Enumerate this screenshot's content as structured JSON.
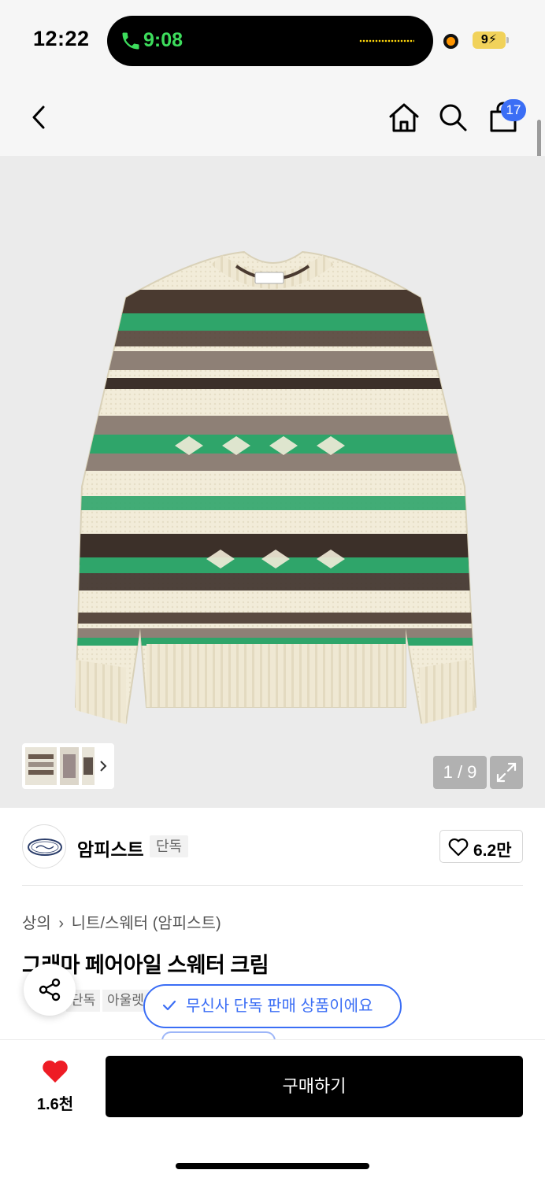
{
  "status_bar": {
    "time": "12:22",
    "call_time": "9:08",
    "battery": "9"
  },
  "header": {
    "cart_count": "17"
  },
  "gallery": {
    "counter": "1 / 9"
  },
  "brand": {
    "name": "암피스트",
    "tag": "단독",
    "likes": "6.2만"
  },
  "product": {
    "breadcrumb": [
      "상의",
      "니트/스웨터 (암피스트)"
    ],
    "title": "그래마 페어아일 스웨터 크림",
    "tags": [
      "단독",
      "아울렛"
    ]
  },
  "toast": {
    "message": "무신사 단독 판매 상품이에요"
  },
  "bottom_bar": {
    "wish_count": "1.6천",
    "buy_label": "구매하기"
  },
  "colors": {
    "accent": "#3b6ef5",
    "heart": "#ee1c25",
    "call_green": "#3ddc5c"
  }
}
